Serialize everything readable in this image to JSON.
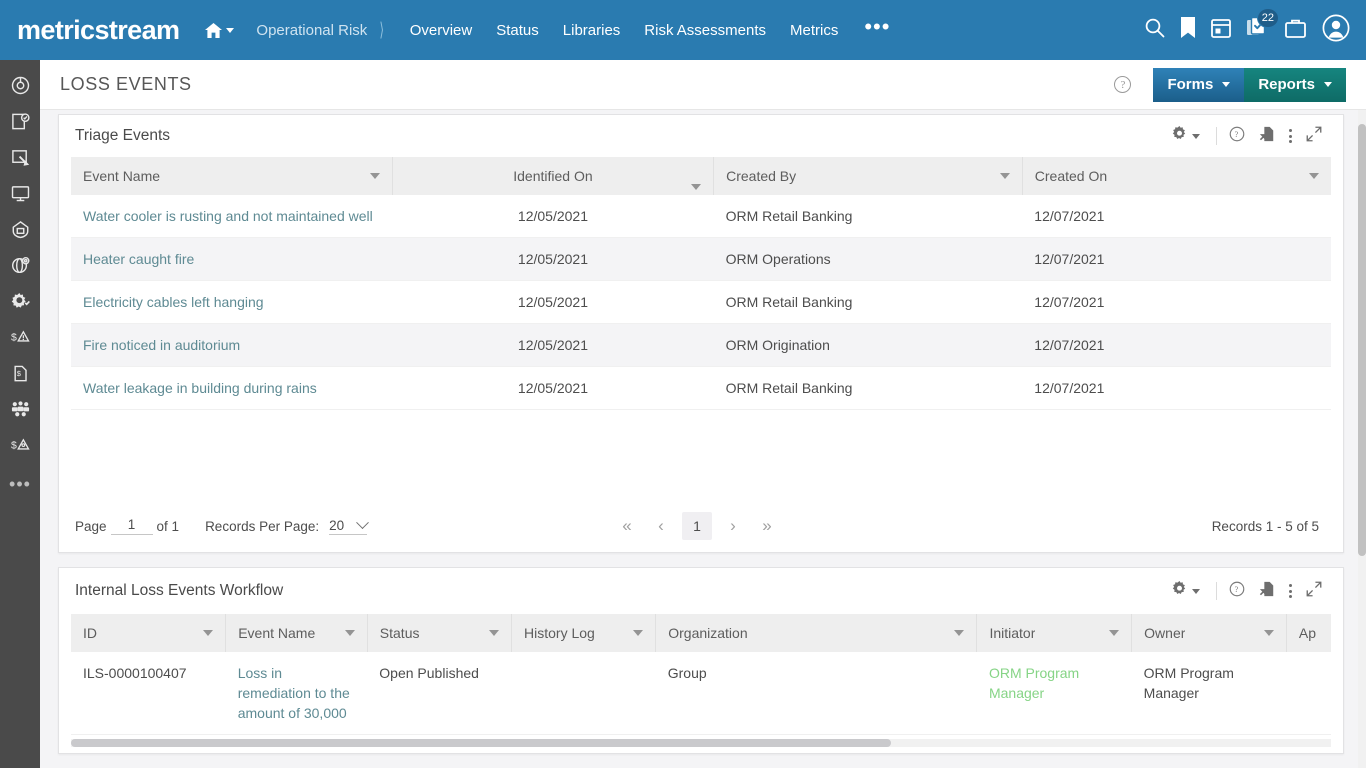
{
  "topnav": {
    "brand": "metricstream",
    "home_icon": "home-icon",
    "breadcrumb": "Operational Risk",
    "links": [
      "Overview",
      "Status",
      "Libraries",
      "Risk Assessments",
      "Metrics"
    ],
    "more_label": "•••",
    "icons": [
      {
        "name": "search-icon"
      },
      {
        "name": "bookmark-icon"
      },
      {
        "name": "calendar-icon"
      },
      {
        "name": "tasks-icon",
        "badge": "22"
      },
      {
        "name": "briefcase-icon"
      },
      {
        "name": "user-avatar-icon"
      }
    ],
    "accent_color": "#2a7bb0"
  },
  "rail": {
    "items": [
      {
        "name": "target-icon"
      },
      {
        "name": "document-check-icon"
      },
      {
        "name": "tag-icon"
      },
      {
        "name": "monitor-icon"
      },
      {
        "name": "shield-home-icon"
      },
      {
        "name": "globe-gear-icon"
      },
      {
        "name": "gear-check-icon"
      },
      {
        "name": "risk-alert-icon"
      },
      {
        "name": "money-document-icon"
      },
      {
        "name": "people-group-icon"
      },
      {
        "name": "risk-people-icon"
      }
    ],
    "more_label": "•••"
  },
  "titlebar": {
    "title": "LOSS EVENTS",
    "help_icon": "help-icon",
    "help_glyph": "?",
    "forms_label": "Forms",
    "reports_label": "Reports",
    "forms_color": "#2f82b8",
    "reports_color": "#16857f"
  },
  "panel_tools": {
    "gear": "gear-icon",
    "help": "help-icon",
    "help_glyph": "?",
    "export": "export-file-icon",
    "kebab": "kebab-menu-icon",
    "expand": "expand-icon"
  },
  "triage": {
    "title": "Triage Events",
    "columns": [
      "Event Name",
      "Identified On",
      "Created By",
      "Created On"
    ],
    "rows": [
      {
        "event": "Water cooler is rusting and not maintained well",
        "identified": "12/05/2021",
        "created_by": "ORM Retail Banking",
        "created_on": "12/07/2021"
      },
      {
        "event": "Heater caught fire",
        "identified": "12/05/2021",
        "created_by": "ORM Operations",
        "created_on": "12/07/2021"
      },
      {
        "event": "Electricity cables left hanging",
        "identified": "12/05/2021",
        "created_by": "ORM Retail Banking",
        "created_on": "12/07/2021"
      },
      {
        "event": "Fire noticed in auditorium",
        "identified": "12/05/2021",
        "created_by": "ORM Origination",
        "created_on": "12/07/2021"
      },
      {
        "event": "Water leakage in building during rains",
        "identified": "12/05/2021",
        "created_by": "ORM Retail Banking",
        "created_on": "12/07/2021"
      }
    ],
    "pager": {
      "page_label": "Page",
      "page_value": "1",
      "of_label": "of 1",
      "rpp_label": "Records Per Page:",
      "rpp_value": "20",
      "first": "«",
      "prev": "‹",
      "current": "1",
      "next": "›",
      "last": "»",
      "records_summary": "Records 1 - 5 of 5"
    }
  },
  "workflow": {
    "title": "Internal Loss Events Workflow",
    "columns": [
      "ID",
      "Event Name",
      "Status",
      "History Log",
      "Organization",
      "Initiator",
      "Owner",
      "Ap"
    ],
    "rows": [
      {
        "id": "ILS-0000100407",
        "event": "Loss in remediation to the amount of 30,000",
        "status": "Open Published",
        "history": "",
        "organization": "Group",
        "initiator": "ORM Program Manager",
        "owner": "ORM Program Manager",
        "ap": ""
      }
    ]
  }
}
